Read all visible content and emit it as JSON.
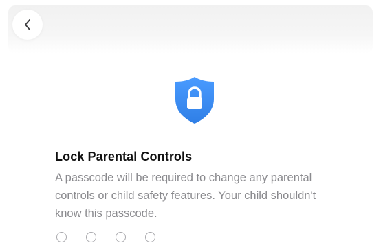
{
  "nav": {
    "back_icon": "chevron-left-icon"
  },
  "header_icon": {
    "name": "shield-lock-icon",
    "color": "#3b8ef3"
  },
  "content": {
    "title": "Lock Parental Controls",
    "description": "A passcode will be required to change any parental controls or child safety features. Your child shouldn't know this passcode."
  },
  "passcode": {
    "length": 4,
    "entered": 0
  }
}
